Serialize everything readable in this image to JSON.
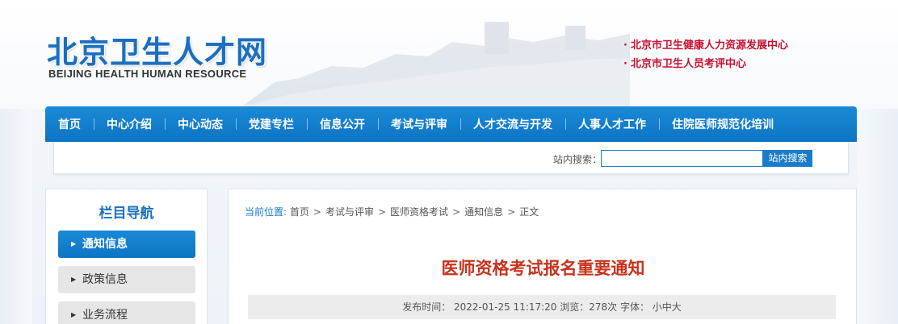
{
  "header": {
    "logo_cn": "北京卫生人才网",
    "logo_en": "BEIJING HEALTH HUMAN RESOURCE",
    "orgs": [
      {
        "label": "北京市卫生健康人力资源发展中心"
      },
      {
        "label": "北京市卫生人员考评中心"
      }
    ]
  },
  "nav": {
    "items": [
      {
        "label": "首页"
      },
      {
        "label": "中心介绍"
      },
      {
        "label": "中心动态"
      },
      {
        "label": "党建专栏"
      },
      {
        "label": "信息公开"
      },
      {
        "label": "考试与评审"
      },
      {
        "label": "人才交流与开发"
      },
      {
        "label": "人事人才工作"
      },
      {
        "label": "住院医师规范化培训"
      }
    ]
  },
  "search": {
    "label": "站内搜索：",
    "value": "",
    "button_label": "站内搜索"
  },
  "sidebar": {
    "title": "栏目导航",
    "items": [
      {
        "label": "通知信息",
        "active": true
      },
      {
        "label": "政策信息",
        "active": false
      },
      {
        "label": "业务流程",
        "active": false
      }
    ]
  },
  "breadcrumb": {
    "lead": "当前位置:",
    "items": [
      "首页",
      "考试与评审",
      "医师资格考试",
      "通知信息",
      "正文"
    ]
  },
  "article": {
    "title": "医师资格考试报名重要通知",
    "meta": "发布时间：  2022-01-25 11:17:20 浏览：278次 字体：  小中大"
  },
  "colors": {
    "brand_blue": "#1a7cc9",
    "brand_red": "#c8102e",
    "title_red": "#c8331e"
  }
}
